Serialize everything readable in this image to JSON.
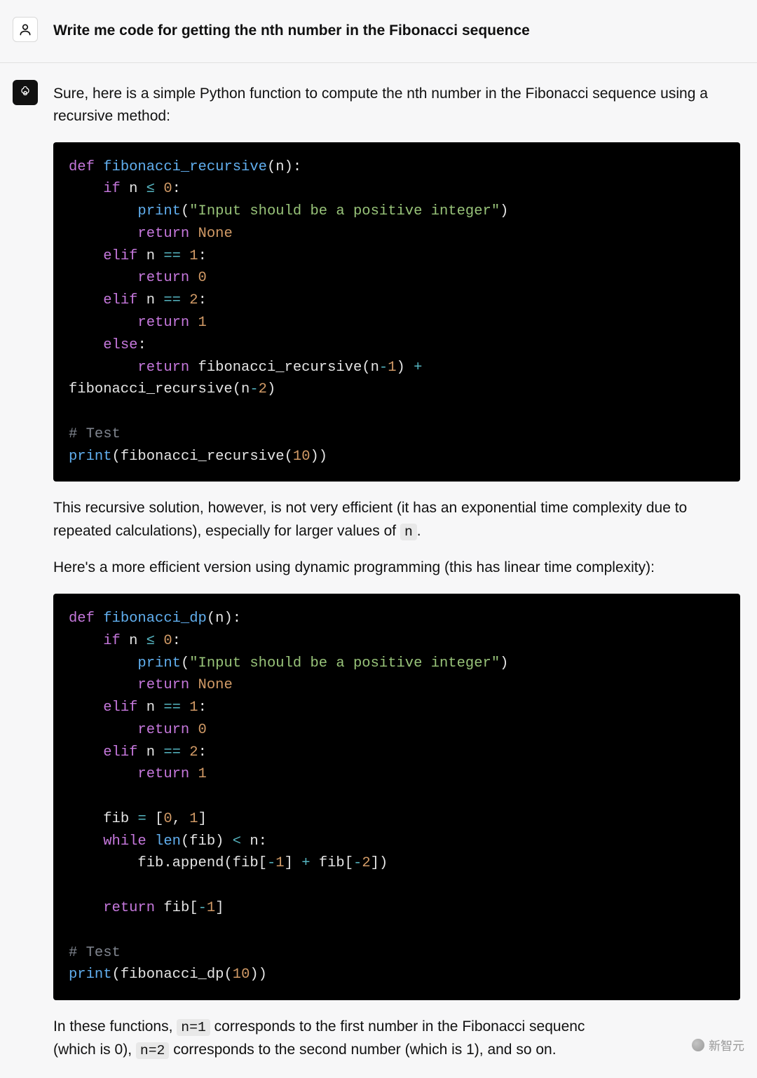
{
  "user": {
    "prompt": "Write me code for getting the nth number in the Fibonacci sequence"
  },
  "assistant": {
    "intro": "Sure, here is a simple Python function to compute the nth number in the Fibonacci sequence using a recursive method:",
    "mid1_a": "This recursive solution, however, is not very efficient (it has an exponential time complexity due to repeated calculations), especially for larger values of ",
    "mid1_code": "n",
    "mid1_b": ".",
    "mid2": "Here's a more efficient version using dynamic programming (this has linear time complexity):",
    "outro_a": "In these functions, ",
    "outro_code1": "n=1",
    "outro_b": " corresponds to the first number in the Fibonacci sequenc",
    "outro_c": "(which is 0), ",
    "outro_code2": "n=2",
    "outro_d": " corresponds to the second number (which is 1), and so on."
  },
  "code1": {
    "kw_def": "def",
    "fn_name": "fibonacci_recursive",
    "open": "(n):\n",
    "kw_if": "if",
    "cond1": " n ",
    "op_le": "≤",
    "sp": " ",
    "num0": "0",
    "colon": ":\n",
    "indent2": "        ",
    "indent1": "    ",
    "fn_print": "print",
    "str_err": "\"Input should be a positive integer\"",
    "close_print": ")\n",
    "kw_return": "return",
    "none": "None",
    "nl": "\n",
    "kw_elif": "elif",
    "op_eq": "==",
    "num1": "1",
    "num2": "2",
    "kw_else": "else",
    "op_minus": "-",
    "op_plus": "+",
    "comment": "# Test",
    "fn_call": "fibonacci_recursive",
    "num10": "10"
  },
  "code2": {
    "fn_name": "fibonacci_dp",
    "fib_var": "fib ",
    "op_assign": "=",
    "list_open": " [",
    "num0": "0",
    "comma": ", ",
    "num1": "1",
    "list_close": "]\n",
    "kw_while": "while",
    "fn_len": "len",
    "paren_fib": "(fib) ",
    "op_lt": "<",
    "n_colon": " n:\n",
    "fn_append": "fib.append",
    "idx_m1": "-1",
    "idx_m2": "-2",
    "ret_last": "fib[",
    "close_idx": "]",
    "num10": "10"
  },
  "watermark": "新智元"
}
